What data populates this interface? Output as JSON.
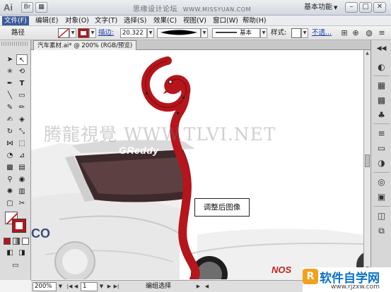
{
  "titlebar": {
    "logo": "Ai",
    "bridge_icon": "br-icon",
    "arrange_icon": "grid-icon",
    "site_name": "思缘设计论坛",
    "site_url": "WWW.MISSYUAN.COM",
    "workspace": "基本功能",
    "window_controls": [
      "–",
      "□",
      "✕"
    ]
  },
  "menu": {
    "items": [
      "文件(F)",
      "编辑(E)",
      "对象(O)",
      "文字(T)",
      "选择(S)",
      "效果(C)",
      "视图(V)",
      "窗口(W)",
      "帮助(H)"
    ]
  },
  "control": {
    "object_label": "路径",
    "stroke_link": "描边:",
    "stroke_value": "20.322",
    "profile_label": "基本",
    "style_label": "样式:",
    "opacity_link": "不透..."
  },
  "document": {
    "tab_title": "汽车素材.ai* @ 200% (RGB/预览)",
    "watermark": "腾龍視覺 WWW.TLVI.NET",
    "callout": "调整后图像",
    "car_logo_text": "GReddy",
    "badge_text": "NOS",
    "sponsor_text": "CO"
  },
  "status": {
    "zoom": "200%",
    "page": "1",
    "mode_label": "编组选择"
  },
  "brand": {
    "logo_letter": "R",
    "name": "软件自学网",
    "url": "www.rjzxw.com"
  },
  "colors": {
    "spiral": "#b5151b",
    "menu_active": "#3b5b99",
    "brand_blue": "#0a72c6"
  }
}
